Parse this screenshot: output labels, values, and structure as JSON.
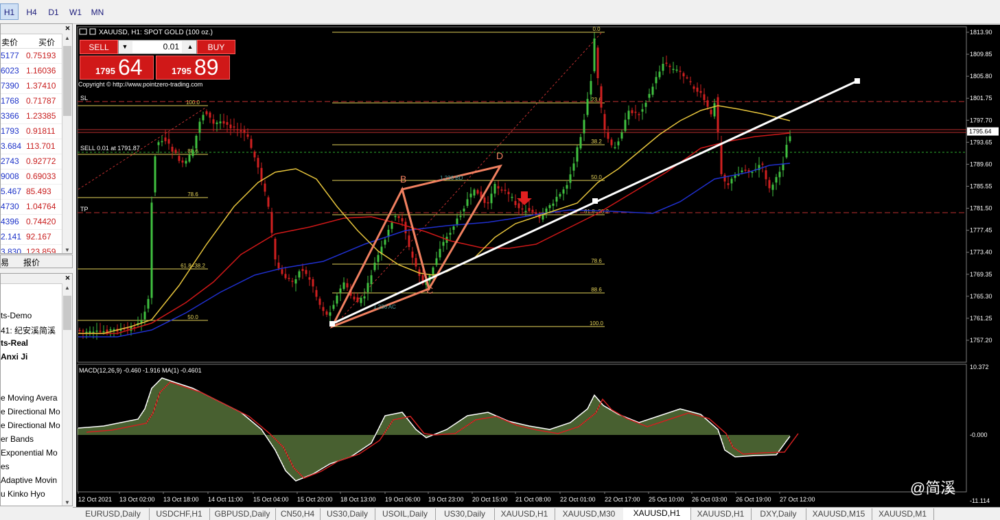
{
  "timeframes": [
    "H1",
    "H4",
    "D1",
    "W1",
    "MN"
  ],
  "active_timeframe": "H1",
  "market_watch": {
    "col_bid": "卖价",
    "col_ask": "买价",
    "rows": [
      {
        "bid": "5177",
        "ask": "0.75193"
      },
      {
        "bid": "6023",
        "ask": "1.16036"
      },
      {
        "bid": "7390",
        "ask": "1.37410"
      },
      {
        "bid": "1768",
        "ask": "0.71787"
      },
      {
        "bid": "3366",
        "ask": "1.23385"
      },
      {
        "bid": "1793",
        "ask": "0.91811"
      },
      {
        "bid": "3.684",
        "ask": "113.701"
      },
      {
        "bid": "2743",
        "ask": "0.92772"
      },
      {
        "bid": "9008",
        "ask": "0.69033"
      },
      {
        "bid": "5.467",
        "ask": "85.493"
      },
      {
        "bid": "4730",
        "ask": "1.04764"
      },
      {
        "bid": "4396",
        "ask": "0.74420"
      },
      {
        "bid": "2.141",
        "ask": "92.167"
      },
      {
        "bid": "3.830",
        "ask": "123.859"
      }
    ],
    "tab_left": "易",
    "tab_right": "报价"
  },
  "navigator": {
    "items": [
      {
        "text": "ts-Demo",
        "bold": false
      },
      {
        "text": "41: 纪安溪简溪",
        "bold": false
      },
      {
        "text": "ts-Real",
        "bold": true
      },
      {
        "text": "Anxi Ji",
        "bold": true
      },
      {
        "text": "e Moving Avera",
        "bold": false
      },
      {
        "text": "e Directional Mo",
        "bold": false
      },
      {
        "text": "e Directional Mo",
        "bold": false
      },
      {
        "text": "er Bands",
        "bold": false
      },
      {
        "text": "Exponential Mo",
        "bold": false
      },
      {
        "text": "es",
        "bold": false
      },
      {
        "text": "Adaptive Movin",
        "bold": false
      },
      {
        "text": "u Kinko Hyo",
        "bold": false
      }
    ]
  },
  "chart": {
    "header": "XAUUSD, H1:  SPOT GOLD (100 oz.)",
    "copyright": "Copyright © http://www.pointzero-trading.com",
    "trade_panel": {
      "sell_label": "SELL",
      "buy_label": "BUY",
      "lot": "0.01",
      "sell_small": "1795",
      "sell_big": "64",
      "buy_small": "1795",
      "buy_big": "89"
    },
    "order_lines": {
      "sl": "SL",
      "tp": "TP",
      "sell": "SELL 0.01 at 1791.87"
    },
    "price_axis": [
      "1813.90",
      "1809.85",
      "1805.80",
      "1801.75",
      "1797.70",
      "1793.65",
      "1789.60",
      "1785.55",
      "1781.50",
      "1777.45",
      "1773.40",
      "1769.35",
      "1765.30",
      "1761.25",
      "1757.20"
    ],
    "current_price": "1795.64",
    "macd_label": "MACD(12,26,9) -0.460 -1.916 MA(1) -0.4601",
    "macd_axis": [
      "10.372",
      "-0.000",
      "-11.114"
    ],
    "time_axis": [
      "12 Oct 2021",
      "13 Oct 02:00",
      "13 Oct 18:00",
      "14 Oct 11:00",
      "15 Oct 04:00",
      "15 Oct 20:00",
      "18 Oct 13:00",
      "19 Oct 06:00",
      "19 Oct 23:00",
      "20 Oct 15:00",
      "21 Oct 08:00",
      "22 Oct 01:00",
      "22 Oct 17:00",
      "25 Oct 10:00",
      "26 Oct 03:00",
      "26 Oct 19:00",
      "27 Oct 12:00"
    ],
    "fib_left": [
      "100.0",
      "88.6",
      "78.6",
      "61.8=38.2",
      "50.0"
    ],
    "fib_right": [
      "0.0",
      "23.6",
      "38.2",
      "50.0",
      "61.8=38.2",
      "78.6",
      "88.6",
      "100.0"
    ],
    "pattern_labels": {
      "b": "B",
      "c": "C",
      "d": "D",
      "bd": "1.236 BD",
      "ac": "1.236 AC"
    }
  },
  "bottom_tabs": [
    "EURUSD,Daily",
    "USDCHF,H1",
    "GBPUSD,Daily",
    "CN50,H4",
    "US30,Daily",
    "USOIL,Daily",
    "US30,Daily",
    "XAUUSD,H1",
    "XAUUSD,M30",
    "XAUUSD,H1",
    "XAUUSD,H1",
    "DXY,Daily",
    "XAUUSD,M15",
    "XAUUSD,M1"
  ],
  "active_bottom_tab": 9,
  "watermark": "@简溪",
  "colors": {
    "bull": "#40c040",
    "bear": "#d02020",
    "ma_red": "#d01818",
    "ma_blue": "#2030d0",
    "ma_yellow": "#e6c43c",
    "fib": "#e6d35a",
    "trend": "#ffffff",
    "pattern": "#f08060"
  }
}
